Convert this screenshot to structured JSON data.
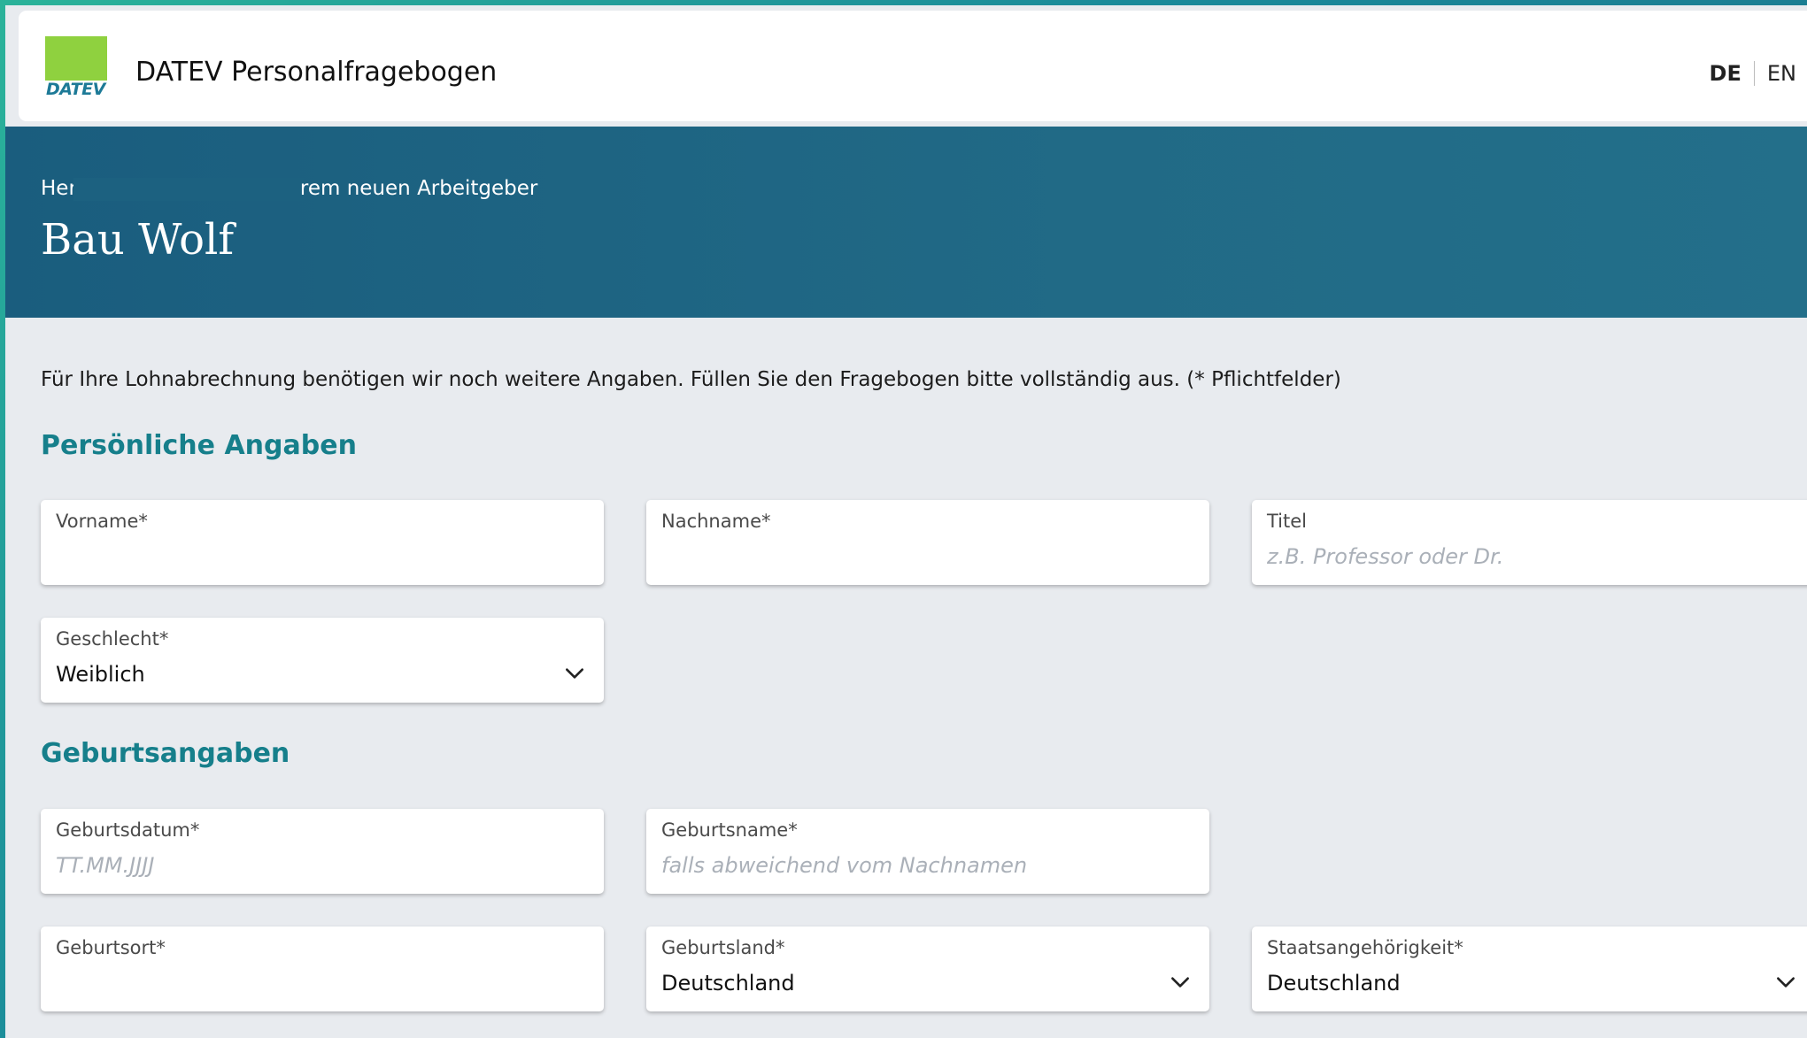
{
  "header": {
    "logo_text": "DATEV",
    "app_title": "DATEV Personalfragebogen",
    "lang_de": "DE",
    "lang_en": "EN"
  },
  "hero": {
    "subtitle_start": "Her",
    "subtitle_end": "rem neuen Arbeitgeber",
    "employer": "Bau Wolf"
  },
  "intro": "Für Ihre Lohnabrechnung benötigen wir noch weitere Angaben. Füllen Sie den Fragebogen bitte vollständig aus. (* Pflichtfelder)",
  "sections": {
    "personal": "Persönliche Angaben",
    "birth": "Geburtsangaben"
  },
  "fields": {
    "vorname": {
      "label": "Vorname*",
      "value": "",
      "placeholder": ""
    },
    "nachname": {
      "label": "Nachname*",
      "value": "",
      "placeholder": ""
    },
    "titel": {
      "label": "Titel",
      "value": "",
      "placeholder": "z.B. Professor oder Dr."
    },
    "geschlecht": {
      "label": "Geschlecht*",
      "value": "Weiblich"
    },
    "geburtsdatum": {
      "label": "Geburtsdatum*",
      "value": "",
      "placeholder": "TT.MM.JJJJ"
    },
    "geburtsname": {
      "label": "Geburtsname*",
      "value": "",
      "placeholder": "falls abweichend vom Nachnamen"
    },
    "geburtsort": {
      "label": "Geburtsort*",
      "value": "",
      "placeholder": ""
    },
    "geburtsland": {
      "label": "Geburtsland*",
      "value": "Deutschland"
    },
    "staatsangehoerigkeit": {
      "label": "Staatsangehörigkeit*",
      "value": "Deutschland"
    }
  },
  "colors": {
    "accent": "#167f8b",
    "hero": "#1d6585",
    "logo_green": "#8fd13f"
  },
  "icons": {
    "select": "chevron-down-icon"
  }
}
